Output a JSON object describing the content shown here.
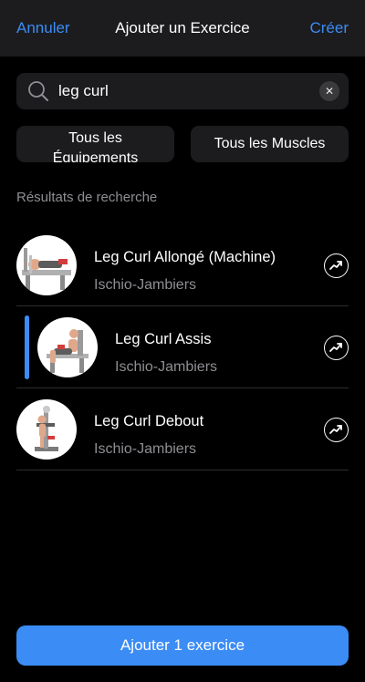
{
  "header": {
    "cancel_label": "Annuler",
    "title": "Ajouter un Exercice",
    "create_label": "Créer"
  },
  "search": {
    "value": "leg curl",
    "icon": "search-icon",
    "clear_icon": "clear-icon"
  },
  "filters": {
    "equipment_label": "Tous les Équipements",
    "muscles_label": "Tous les Muscles"
  },
  "section_label": "Résultats de recherche",
  "results": [
    {
      "name": "Leg Curl Allongé (Machine)",
      "muscle": "Ischio-Jambiers",
      "selected": false
    },
    {
      "name": "Leg Curl Assis",
      "muscle": "Ischio-Jambiers",
      "selected": true
    },
    {
      "name": "Leg Curl Debout",
      "muscle": "Ischio-Jambiers",
      "selected": false
    }
  ],
  "add_button_label": "Ajouter 1 exercice",
  "colors": {
    "accent": "#3b8cf5",
    "surface": "#1c1c1e",
    "muted_text": "#8e8e93"
  }
}
